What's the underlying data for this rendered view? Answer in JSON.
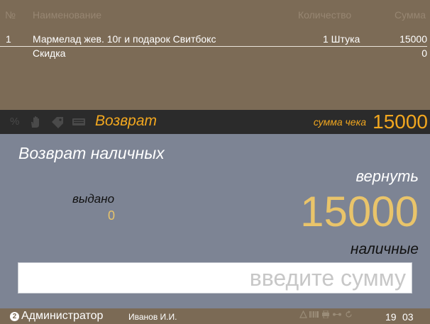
{
  "receipt": {
    "columns": {
      "num": "№",
      "name": "Наименование",
      "qty": "Количество",
      "sum": "Сумма"
    },
    "items": [
      {
        "num": "1",
        "name": "Мармелад жев. 10г и подарок Свитбокс",
        "qty": "1 Штука",
        "sum": "15000"
      }
    ],
    "discount_label": "Скидка",
    "discount_value": "0"
  },
  "toolbar": {
    "icons": [
      "percent-icon",
      "hand-icon",
      "tag-icon",
      "keyboard-icon"
    ],
    "percent_glyph": "%",
    "mode_title": "Возврат",
    "total_label": "сумма чека",
    "total_value": "15000",
    "accent_color": "#f2a71f"
  },
  "main": {
    "title": "Возврат наличных",
    "return_label": "вернуть",
    "return_amount": "15000",
    "issued_label": "выдано",
    "issued_value": "0",
    "payment_type": "наличные",
    "amount_input": {
      "value": "",
      "placeholder": "введите сумму"
    }
  },
  "status": {
    "user_badge": "2",
    "user_role": "Администратор",
    "user_name": "Иванов И.И.",
    "icons": [
      "warning-icon",
      "barcode-icon",
      "printer-icon",
      "network-icon",
      "sync-icon"
    ],
    "clock_time": "19",
    "clock_extra": "03"
  }
}
